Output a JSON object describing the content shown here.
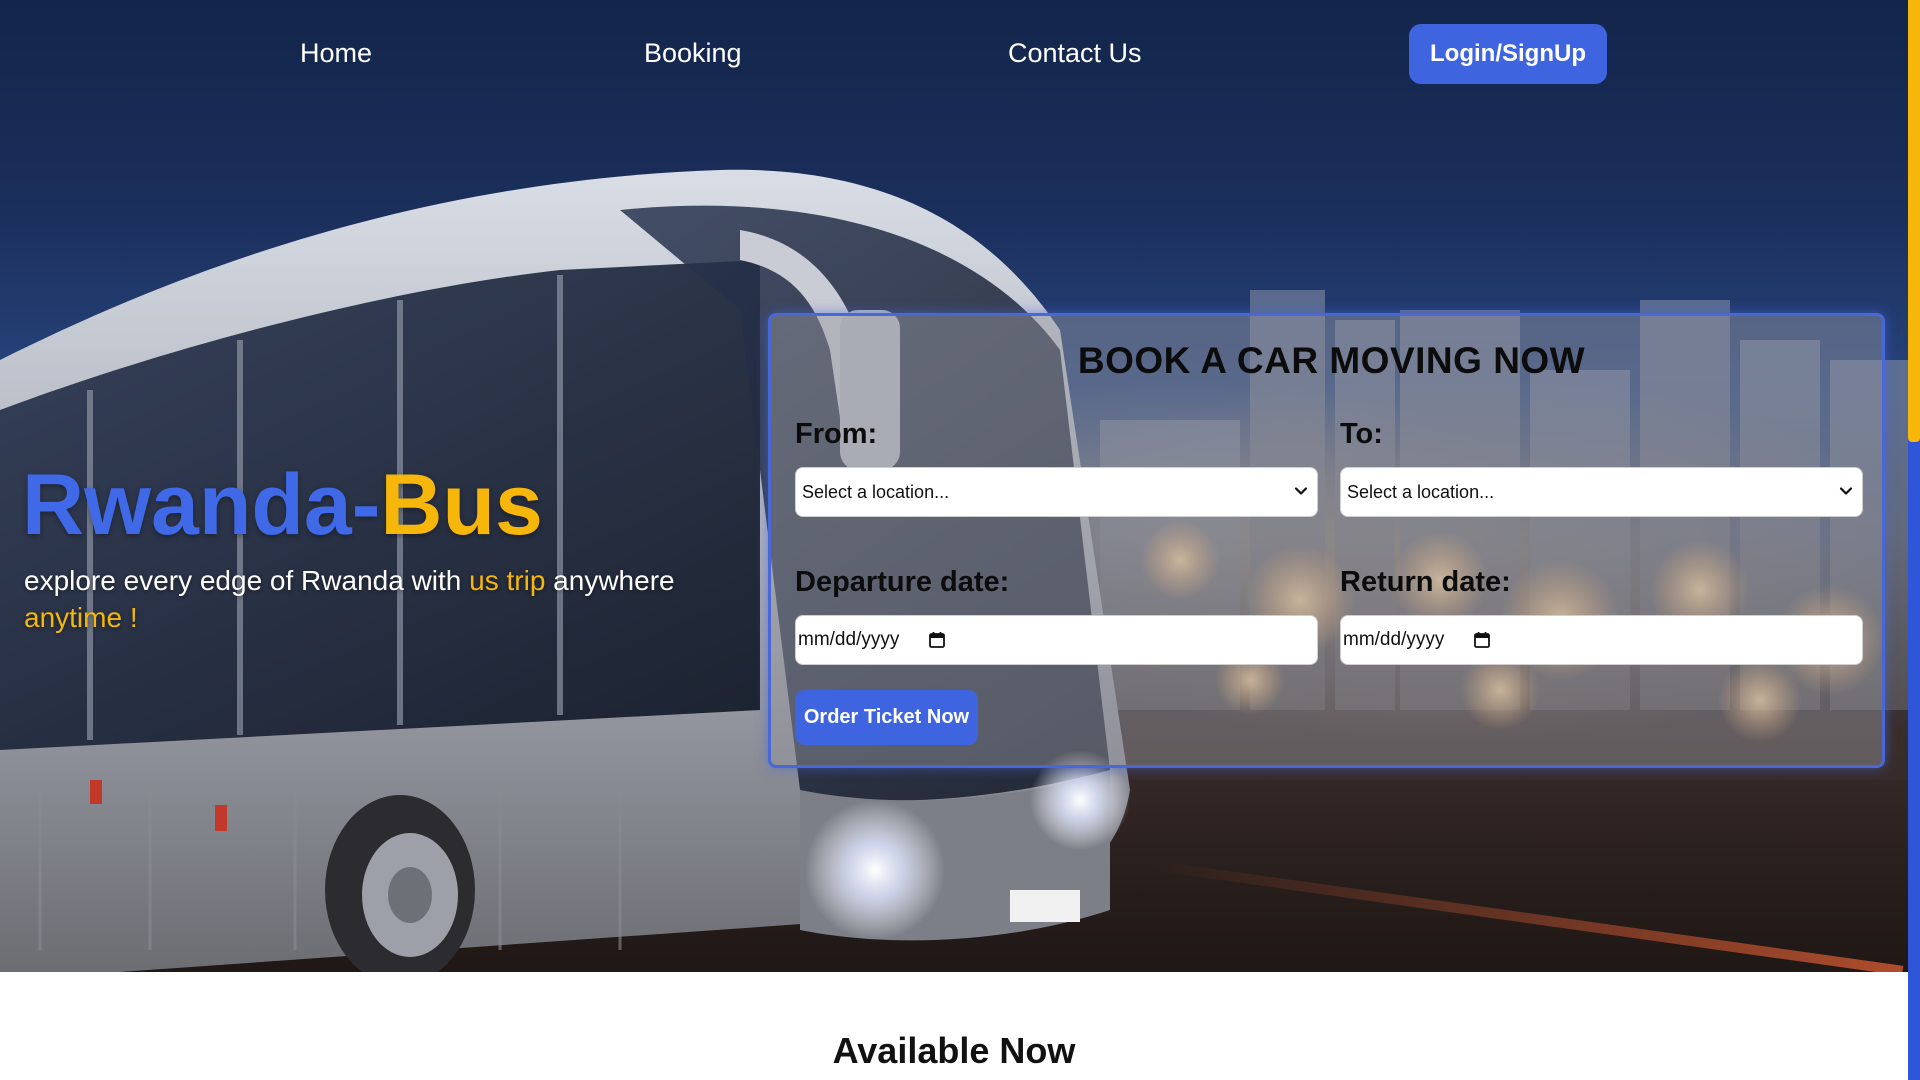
{
  "nav": {
    "home": "Home",
    "booking": "Booking",
    "contact": "Contact Us",
    "login": "Login/SignUp"
  },
  "hero": {
    "brand_part1": "Rwanda-",
    "brand_part2": "Bus",
    "tagline_part1": "explore every edge of Rwanda with ",
    "tagline_highlight1": "us trip",
    "tagline_part2": " anywhere ",
    "tagline_highlight2": "anytime !"
  },
  "booking": {
    "title": "BOOK A CAR MOVING NOW",
    "from_label": "From:",
    "to_label": "To:",
    "from_value": "Select a location...",
    "to_value": "Select a location...",
    "departure_label": "Departure date:",
    "return_label": "Return date:",
    "departure_value": "mm/dd/yyyy",
    "return_value": "mm/dd/yyyy",
    "order_button": "Order Ticket Now"
  },
  "section": {
    "available_title": "Available Now"
  },
  "colors": {
    "accent_blue": "#3f64e0",
    "accent_yellow": "#f6b70a"
  },
  "icons": {
    "select_arrow": "chevron-down-icon",
    "date_picker": "calendar-icon"
  }
}
